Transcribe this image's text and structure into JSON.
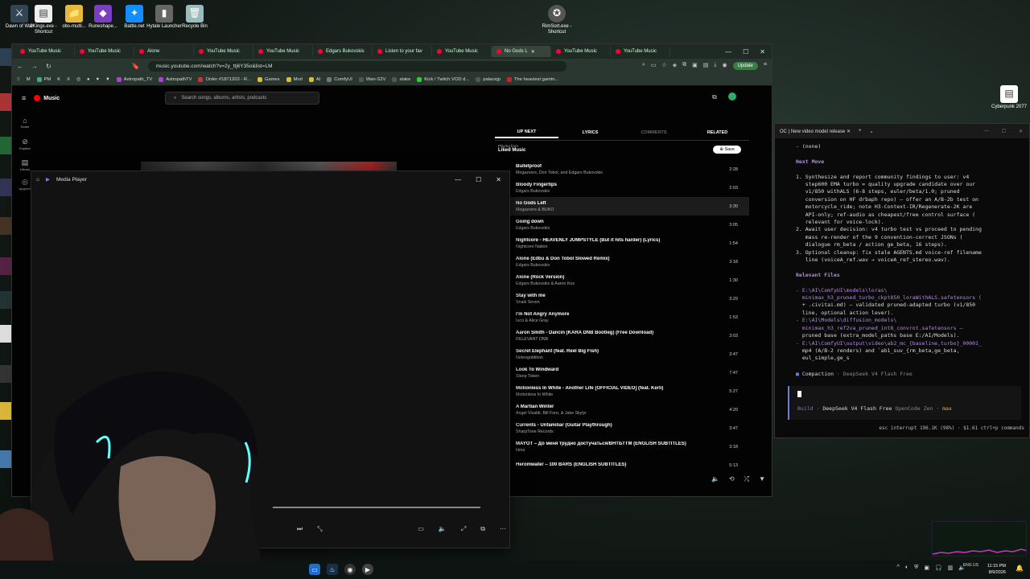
{
  "desktop": {
    "icons": [
      "Dawn of War",
      "9Kings.exe - Shortcut",
      "obs-multi...",
      "Runeshape...",
      "Battle.net",
      "Hytale Launcher",
      "Recycle Bin",
      "RimSort.exe - Shortcut",
      "Cyberpunk 2077"
    ]
  },
  "browser": {
    "tabs": [
      {
        "label": "YouTube Music"
      },
      {
        "label": "YouTube Music"
      },
      {
        "label": "Alone"
      },
      {
        "label": "YouTube Music"
      },
      {
        "label": "YouTube Music"
      },
      {
        "label": "Edgars Bukovskis"
      },
      {
        "label": "Listen to your fav"
      },
      {
        "label": "YouTube Music"
      },
      {
        "label": "No Gods L"
      },
      {
        "label": "YouTube Music"
      },
      {
        "label": "YouTube Music"
      }
    ],
    "url": "music.youtube.com/watch?v=2y_ttj6Y35o&list=LM",
    "update_label": "Update",
    "bookmarks": [
      "PM",
      "Astropath_TV",
      "AstropathTV",
      "Order #1871203 - R...",
      "Games",
      "Mod",
      "AI",
      "ComfyUI",
      "Wan-S2V",
      "stake",
      "Kick / Twitch VOD d...",
      "palacejp",
      "The heaviest gamin..."
    ]
  },
  "ytmusic": {
    "logo": "Music",
    "search_placeholder": "Search songs, albums, artists, podcasts",
    "sidebar": [
      "Home",
      "Explore",
      "Library",
      "Upgrade"
    ],
    "queue_tabs": {
      "up_next": "UP NEXT",
      "lyrics": "LYRICS",
      "comments": "COMMENTS",
      "related": "RELATED"
    },
    "playing_from_label": "Playing from",
    "playing_from_name": "Liked Music",
    "save_label": "Save",
    "tracks": [
      {
        "title": "Bulletproof",
        "artist": "Megazvers, Don Tobol, and Edgars Bukovskis",
        "duration": "2:28"
      },
      {
        "title": "Bloody Fingertips",
        "artist": "Edgars Bukovskis",
        "duration": "2:03"
      },
      {
        "title": "No Gods Left",
        "artist": "Megazvers & BUKO",
        "duration": "3:30"
      },
      {
        "title": "Going down",
        "artist": "Edgars Bukovskis",
        "duration": "3:05"
      },
      {
        "title": "Nightcore - HEAVENLY JUMPSTYLE (But it hits harder) (Lyrics)",
        "artist": "Nightcore Nation",
        "duration": "1:54"
      },
      {
        "title": "Alone (Edbu & Don Tobol Slowed Remix)",
        "artist": "Edgars Bukovskis",
        "duration": "3:18"
      },
      {
        "title": "Alone (Rock Version)",
        "artist": "Edgars Bukovskis & Aaron Kos",
        "duration": "1:30"
      },
      {
        "title": "Stay with me",
        "artist": "Snaik Seven",
        "duration": "3:29"
      },
      {
        "title": "I'm Not Angry Anymore",
        "artist": "Iuco & Alice Gray",
        "duration": "1:53"
      },
      {
        "title": "Aaron Smith - Dancin (KARA DNB Bootleg) (Free Download)",
        "artist": "RELEVANT DNB",
        "duration": "3:03"
      },
      {
        "title": "Secret Elephant (feat. Reel Big Fish)",
        "artist": "Nekrogoblikon",
        "duration": "3:47"
      },
      {
        "title": "Look To Windward",
        "artist": "Sleep Token",
        "duration": "7:47"
      },
      {
        "title": "Motionless In White - Another Life [OFFICIAL VIDEO] (feat. Kerli)",
        "artist": "Motionless In White",
        "duration": "5:27"
      },
      {
        "title": "A Martian Winter",
        "artist": "Angel Vivaldi, Bill Fore, & Jake Skylyr",
        "duration": "4:20"
      },
      {
        "title": "Currents - Unfamiliar (Guitar Playthrough)",
        "artist": "SharpTone Records",
        "duration": "3:47"
      },
      {
        "title": "MAYOT – До меня трудно достучаться/ВНТБТТМ (ENGLISH SUBTITLES)",
        "artist": "tiima",
        "duration": "3:18"
      },
      {
        "title": "Heromwater – 100 BARS (ENGLISH SUBTITLES)",
        "artist": "",
        "duration": "5:13"
      }
    ]
  },
  "media_player": {
    "title": "Media Player"
  },
  "terminal": {
    "tab_title": "OC | New video model release",
    "lines": [
      {
        "text": "- (none)",
        "style": "kw"
      },
      {
        "text": "",
        "style": "kw"
      },
      {
        "text": "Next Move",
        "style": "purple"
      },
      {
        "text": "",
        "style": "kw"
      },
      {
        "text": "1. Synthesize and report community findings to user: v4",
        "style": "kw"
      },
      {
        "text": "   step600 EMA turbo = quality upgrade candidate over our",
        "style": "kw"
      },
      {
        "text": "   v1/850 withALS (6-8 steps, euler/beta/1.0; pruned",
        "style": "kw"
      },
      {
        "text": "   conversion on HF drbaph repo) – offer an A/B-2b test on",
        "style": "kw"
      },
      {
        "text": "   motorcycle_ride; note H3-Context-IR/Regenerate-2K are",
        "style": "kw"
      },
      {
        "text": "   API-only; ref-audio as cheapest/free control surface (",
        "style": "kw"
      },
      {
        "text": "   relevant for voice-lock).",
        "style": "kw"
      },
      {
        "text": "2. Await user decision: v4 turbo test vs proceed to pending",
        "style": "kw"
      },
      {
        "text": "   mass re-render of the 9 convention-correct JSONs (",
        "style": "kw"
      },
      {
        "text": "   dialogue rm_beta / action ge_beta, 16 steps).",
        "style": "kw"
      },
      {
        "text": "3. Optional cleanup: fix stale AGENTS.md voice-ref filename",
        "style": "kw"
      },
      {
        "text": "   line (voiceA_ref.wav → voiceA_ref_stereo.wav).",
        "style": "kw"
      },
      {
        "text": "",
        "style": "kw"
      },
      {
        "text": "Relevant Files",
        "style": "purple"
      },
      {
        "text": "",
        "style": "kw"
      },
      {
        "text": "- E:\\AI\\ComfyUI\\models\\loras\\",
        "style": "path"
      },
      {
        "text": "  minimax_h3_pruned_turbo_ckpt850_loraWithALS.safetensors (",
        "style": "path"
      },
      {
        "text": "  + .civitai.md) – validated pruned-adapted turbo (v1/850",
        "style": "kw"
      },
      {
        "text": "  line, optional action lever).",
        "style": "kw"
      },
      {
        "text": "- E:\\AI\\Models\\diffusion_models\\",
        "style": "path"
      },
      {
        "text": "  minimax_h3_ref2va_pruned_int8_convrot.safetensors –",
        "style": "path"
      },
      {
        "text": "  pruned base (extra_model_paths base E:/AI/Models).",
        "style": "kw"
      },
      {
        "text": "- E:\\AI\\ComfyUI\\output\\video\\ab2_mc_{baseline,turbo}_00001_",
        "style": "path"
      },
      {
        "text": "  mp4 (A/B-2 renders) and `ab1_suv_{rm_beta,ge_beta,",
        "style": "kw"
      },
      {
        "text": "  eul_simple,ge_s",
        "style": "kw"
      }
    ],
    "compaction_label": "Compaction",
    "compaction_model": "DeepSeek V4 Flash Free",
    "build_label": "Build",
    "build_model": "DeepSeek V4 Flash Free",
    "build_provider": "OpenCode Zen",
    "build_mode": "max",
    "status": "esc interrupt  196.1K (98%) · $1.61  ctrl+p commands"
  },
  "taskbar": {
    "lang": "ENG US",
    "time": "11:15 PM",
    "date": "8/9/2026"
  },
  "colors": {
    "accent": "#b48be3",
    "yt_red": "#ff0000",
    "update_green": "#3a7d44"
  }
}
